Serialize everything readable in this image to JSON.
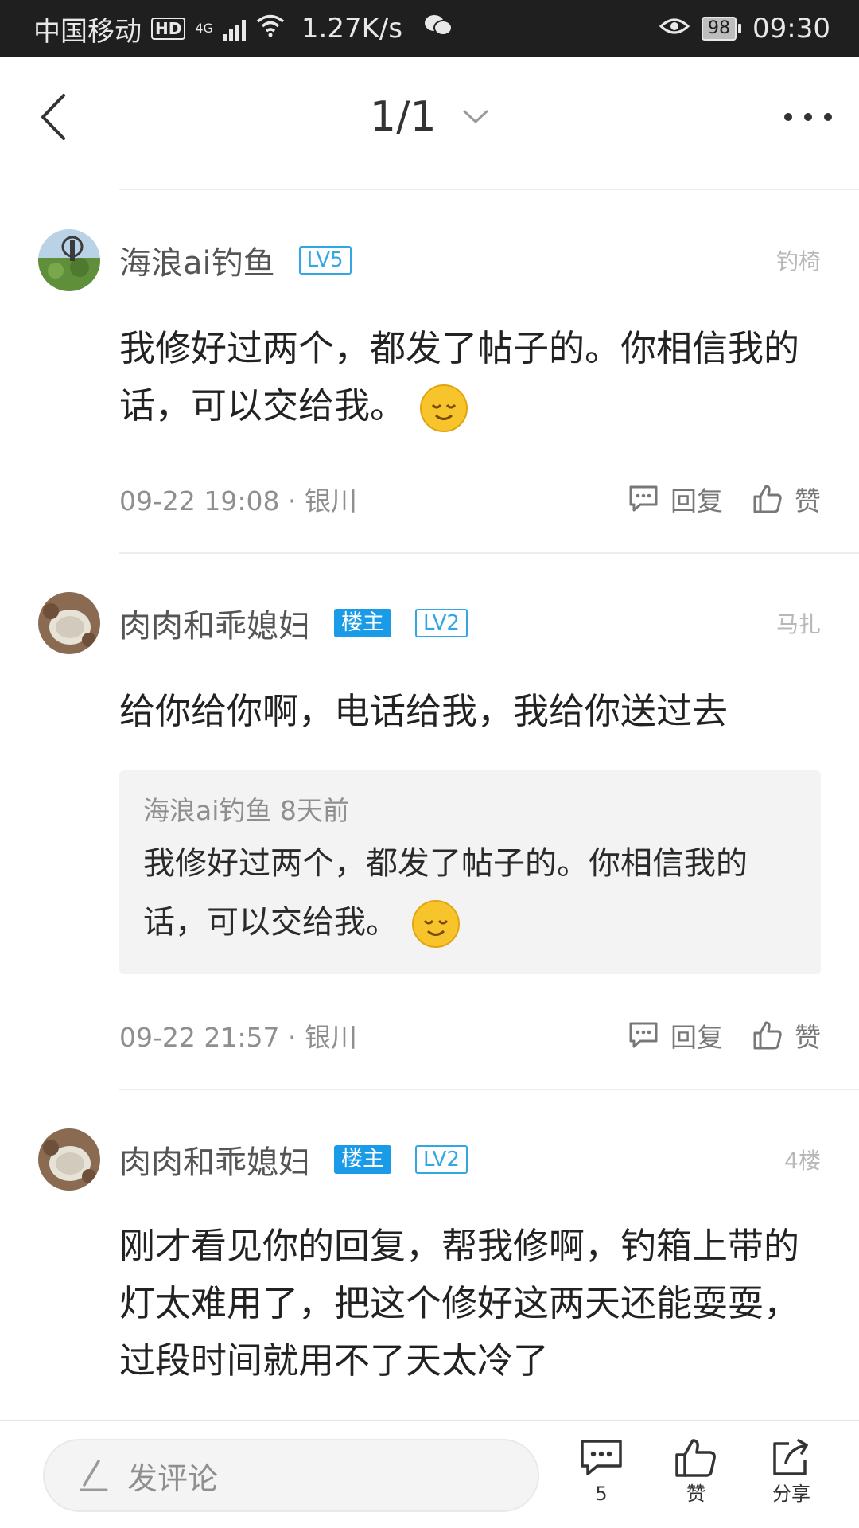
{
  "status_bar": {
    "carrier": "中国移动",
    "hd": "HD",
    "network": "4G",
    "speed": "1.27K/s",
    "battery": "98",
    "time": "09:30",
    "text_color": "#e8e8e8"
  },
  "header": {
    "page_indicator": "1/1"
  },
  "comments": [
    {
      "username": "海浪ai钓鱼",
      "level": "LV5",
      "floor": "钓椅",
      "text": "我修好过两个，都发了帖子的。你相信我的话，可以交给我。",
      "has_emoji": true,
      "time_location": "09-22 19:08 · 银川",
      "reply_label": "回复",
      "like_label": "赞"
    },
    {
      "username": "肉肉和乖媳妇",
      "owner_badge": "楼主",
      "level": "LV2",
      "floor": "马扎",
      "text": "给你给你啊，电话给我，我给你送过去",
      "quote": {
        "meta": "海浪ai钓鱼 8天前",
        "text": "我修好过两个，都发了帖子的。你相信我的话，可以交给我。",
        "has_emoji": true
      },
      "time_location": "09-22 21:57 · 银川",
      "reply_label": "回复",
      "like_label": "赞"
    },
    {
      "username": "肉肉和乖媳妇",
      "owner_badge": "楼主",
      "level": "LV2",
      "floor": "4楼",
      "text": "刚才看见你的回复，帮我修啊，钓箱上带的灯太难用了，把这个修好这两天还能耍耍，过段时间就用不了天太冷了"
    }
  ],
  "bottom_bar": {
    "comment_placeholder": "发评论",
    "comment_count": "5",
    "like_label": "赞",
    "share_label": "分享"
  },
  "colors": {
    "accent": "#1a9be8",
    "level_badge": "#33a6e6",
    "meta_text": "#8f8f8f",
    "divider": "#ededed"
  },
  "icons": [
    "back-icon",
    "chevron-down-icon",
    "more-icon",
    "comment-icon",
    "thumb-up-icon",
    "share-icon",
    "pen-icon",
    "smile-emoji-icon"
  ]
}
